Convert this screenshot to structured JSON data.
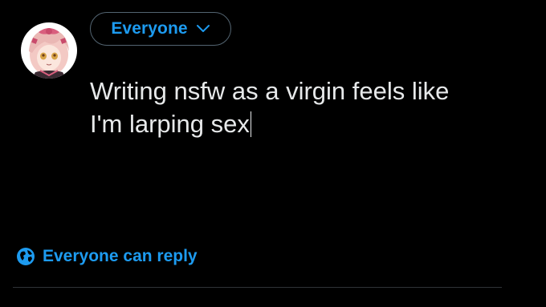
{
  "composer": {
    "audience_label": "Everyone",
    "text_line1": "Writing nsfw as a virgin feels like",
    "text_line2": "I'm larping sex",
    "reply_setting_label": "Everyone can reply"
  },
  "icons": {
    "avatar": "avatar-image",
    "audience_dropdown": "chevron-down-icon",
    "reply_setting": "globe-icon"
  },
  "colors": {
    "background": "#000000",
    "accent": "#1d9bf0",
    "text": "#e7e9ea",
    "border": "#536471",
    "divider": "#2f3336"
  }
}
